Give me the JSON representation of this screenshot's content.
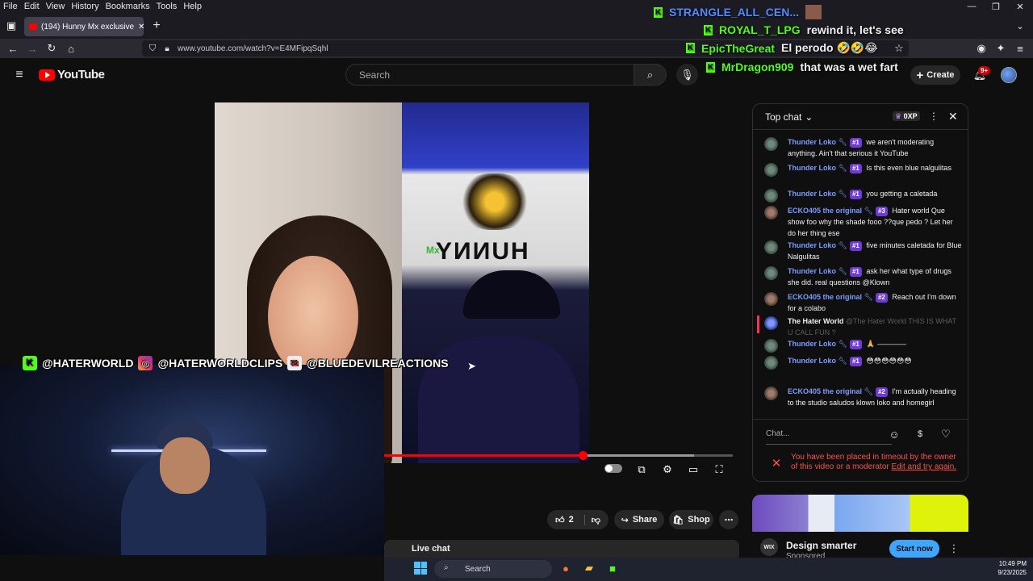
{
  "browser": {
    "menu": [
      "File",
      "Edit",
      "View",
      "History",
      "Bookmarks",
      "Tools",
      "Help"
    ],
    "tab_title": "(194) Hunny Mx exclusive",
    "url": "www.youtube.com/watch?v=E4MFipqSqhl"
  },
  "youtube": {
    "logo_text": "YouTube",
    "search_placeholder": "Search",
    "create_label": "Create",
    "notification_count": "9+",
    "video": {
      "progress_fraction": 0.57,
      "buffer_fraction": 0.89
    },
    "likes": "2",
    "share_label": "Share",
    "shop_label": "Shop",
    "live_chat_label": "Live chat"
  },
  "video_overlay": {
    "brand_text": "HUNNY",
    "brand_small": "Mx",
    "socials": [
      "@HATERWORLD",
      "@HATERWORLDCLIPS",
      "@BLUEDEVILREACTIONS"
    ]
  },
  "overlay_chat": [
    {
      "user": "STRANGLE_ALL_CEN...",
      "text": ""
    },
    {
      "user": "ROYAL_T_LPG",
      "text": "rewind it, let's see"
    },
    {
      "user": "EpicTheGreat",
      "text": "El perodo 🤣🤣😂"
    },
    {
      "user": "MrDragon909",
      "text": "that was a wet fart"
    }
  ],
  "chat": {
    "header": "Top chat",
    "xp": "0XP",
    "messages": [
      {
        "name": "Thunder Loko",
        "badge": "#1",
        "text": "we aren't moderating anything. Ain't that serious it YouTube"
      },
      {
        "name": "Thunder Loko",
        "badge": "#1",
        "text": "Is this even blue nalgulitas"
      },
      {
        "name": "Thunder Loko",
        "badge": "#1",
        "text": "you getting a caletada"
      },
      {
        "name": "ECKO405 the original",
        "badge": "#3",
        "text": "Hater world Que show foo why the shade fooo ??que pedo ? Let her do her thing ese"
      },
      {
        "name": "Thunder Loko",
        "badge": "#1",
        "text": "five minutes caletada for Blue Nalgulitas"
      },
      {
        "name": "Thunder Loko",
        "badge": "#1",
        "text": "ask her what type of drugs she did. real questions @Klown"
      },
      {
        "name": "ECKO405 the original",
        "badge": "#2",
        "text": "Reach out I'm down for a colabo"
      },
      {
        "name": "The Hater World",
        "badge": "",
        "text": "@The Hater World THIS IS WHAT U CALL FUN ?"
      },
      {
        "name": "Thunder Loko",
        "badge": "#1",
        "text": "🙏 ————"
      },
      {
        "name": "Thunder Loko",
        "badge": "#1",
        "text": "😳😳😳😳😳😳"
      },
      {
        "name": "ECKO405 the original",
        "badge": "#2",
        "text": "I'm actually heading to the studio saludos klown loko and homegirl"
      }
    ],
    "input_placeholder": "Chat...",
    "timeout_text": "You have been placed in timeout by the owner of this video or a moderator",
    "timeout_link": "Edit and try again."
  },
  "ad": {
    "title": "Design smarter",
    "sub": "Sponsored",
    "cta": "Start now"
  },
  "taskbar": {
    "search": "Search",
    "time": "10:49 PM",
    "date": "9/23/2025"
  },
  "colors": {
    "accent_red": "#ff0000",
    "kick_green": "#53fc18",
    "badge_purple": "#6f3bd8",
    "link_blue": "#3ea6ff"
  }
}
